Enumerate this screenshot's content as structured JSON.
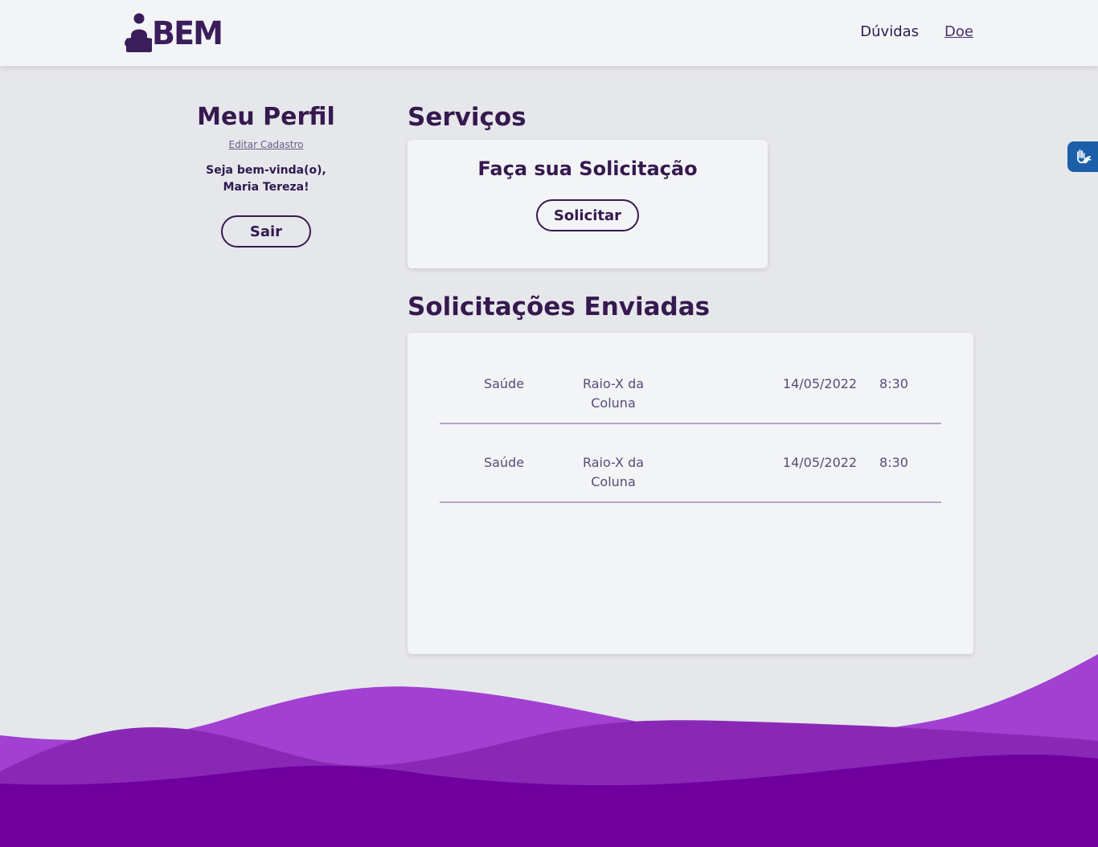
{
  "header": {
    "logo_text": "BEM",
    "nav": [
      {
        "label": "Dúvidas"
      },
      {
        "label": "Doe"
      }
    ]
  },
  "profile": {
    "title": "Meu Perfil",
    "edit_link": "Editar Cadastro",
    "welcome_line1": "Seja bem-vinda(o),",
    "welcome_line2": "Maria Tereza!",
    "logout_label": "Sair"
  },
  "services": {
    "title": "Serviços",
    "card_title": "Faça sua Solicitação",
    "request_label": "Solicitar"
  },
  "requests": {
    "title": "Solicitações Enviadas",
    "rows": [
      {
        "category": "Saúde",
        "exam": "Raio-X da Coluna",
        "date": "14/05/2022",
        "time": "8:30"
      },
      {
        "category": "Saúde",
        "exam": "Raio-X da Coluna",
        "date": "14/05/2022",
        "time": "8:30"
      }
    ]
  },
  "colors": {
    "brand": "#35194f",
    "wave_light": "#a240d2",
    "wave_mid": "#8a28b6",
    "wave_dark": "#6f009e",
    "a11y_blue": "#1a5fa8"
  },
  "icons": {
    "logo": "person-reading-icon",
    "accessibility": "sign-language-hands-icon"
  }
}
